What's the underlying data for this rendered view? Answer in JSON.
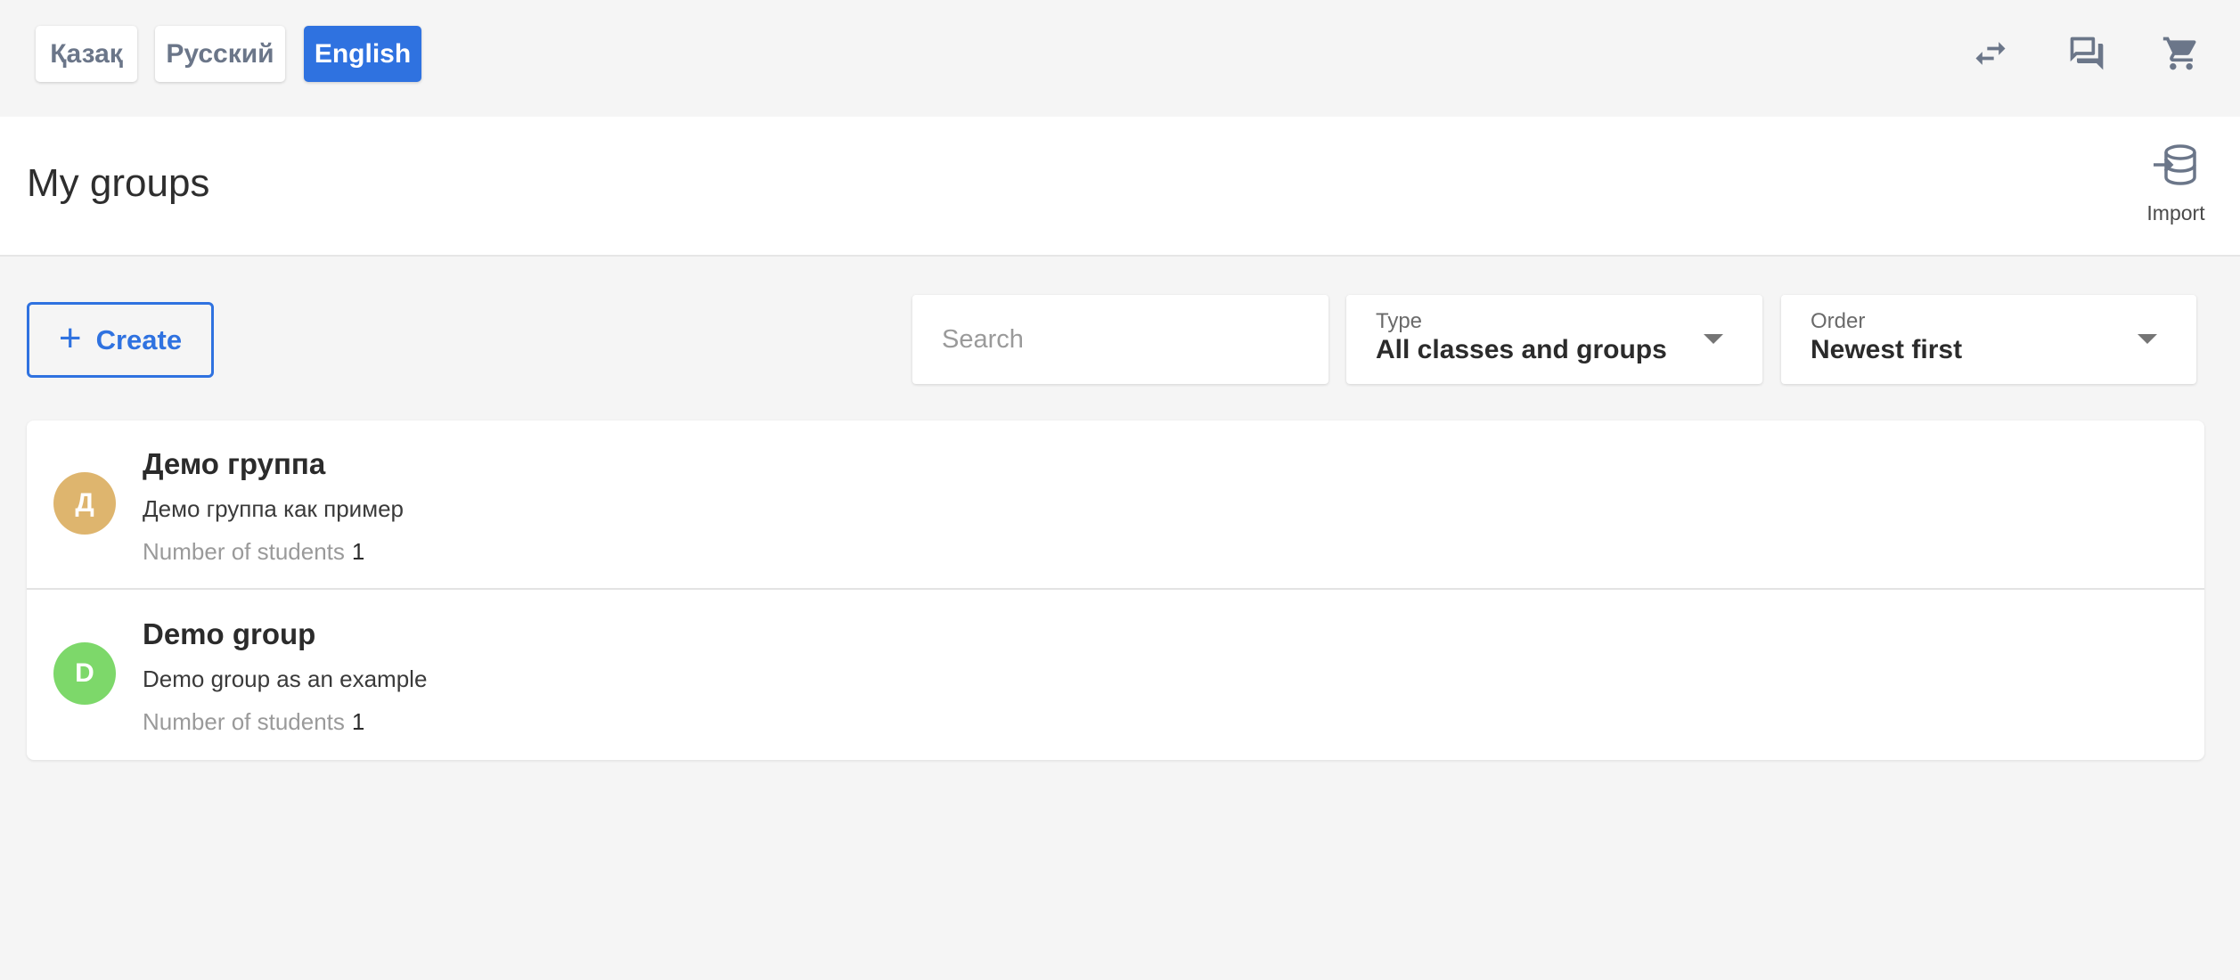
{
  "languages": [
    {
      "label": "Қазақ",
      "active": false
    },
    {
      "label": "Русский",
      "active": false
    },
    {
      "label": "English",
      "active": true
    }
  ],
  "top_icons": [
    "swap-icon",
    "chat-icon",
    "cart-icon"
  ],
  "header": {
    "title": "My groups",
    "import_label": "Import"
  },
  "toolbar": {
    "create_label": "Create",
    "search_placeholder": "Search",
    "type": {
      "label": "Type",
      "value": "All classes and groups"
    },
    "order": {
      "label": "Order",
      "value": "Newest first"
    }
  },
  "groups": [
    {
      "initial": "Д",
      "name": "Демо группа",
      "description": "Демо группа как пример",
      "students_label": "Number of students",
      "students_count": "1",
      "avatar_color": "#deb56e"
    },
    {
      "initial": "D",
      "name": "Demo group",
      "description": "Demo group as an example",
      "students_label": "Number of students",
      "students_count": "1",
      "avatar_color": "#7dd86a"
    }
  ],
  "colors": {
    "accent": "#2f72e0",
    "icon": "#6b7689",
    "background": "#f5f5f5"
  }
}
